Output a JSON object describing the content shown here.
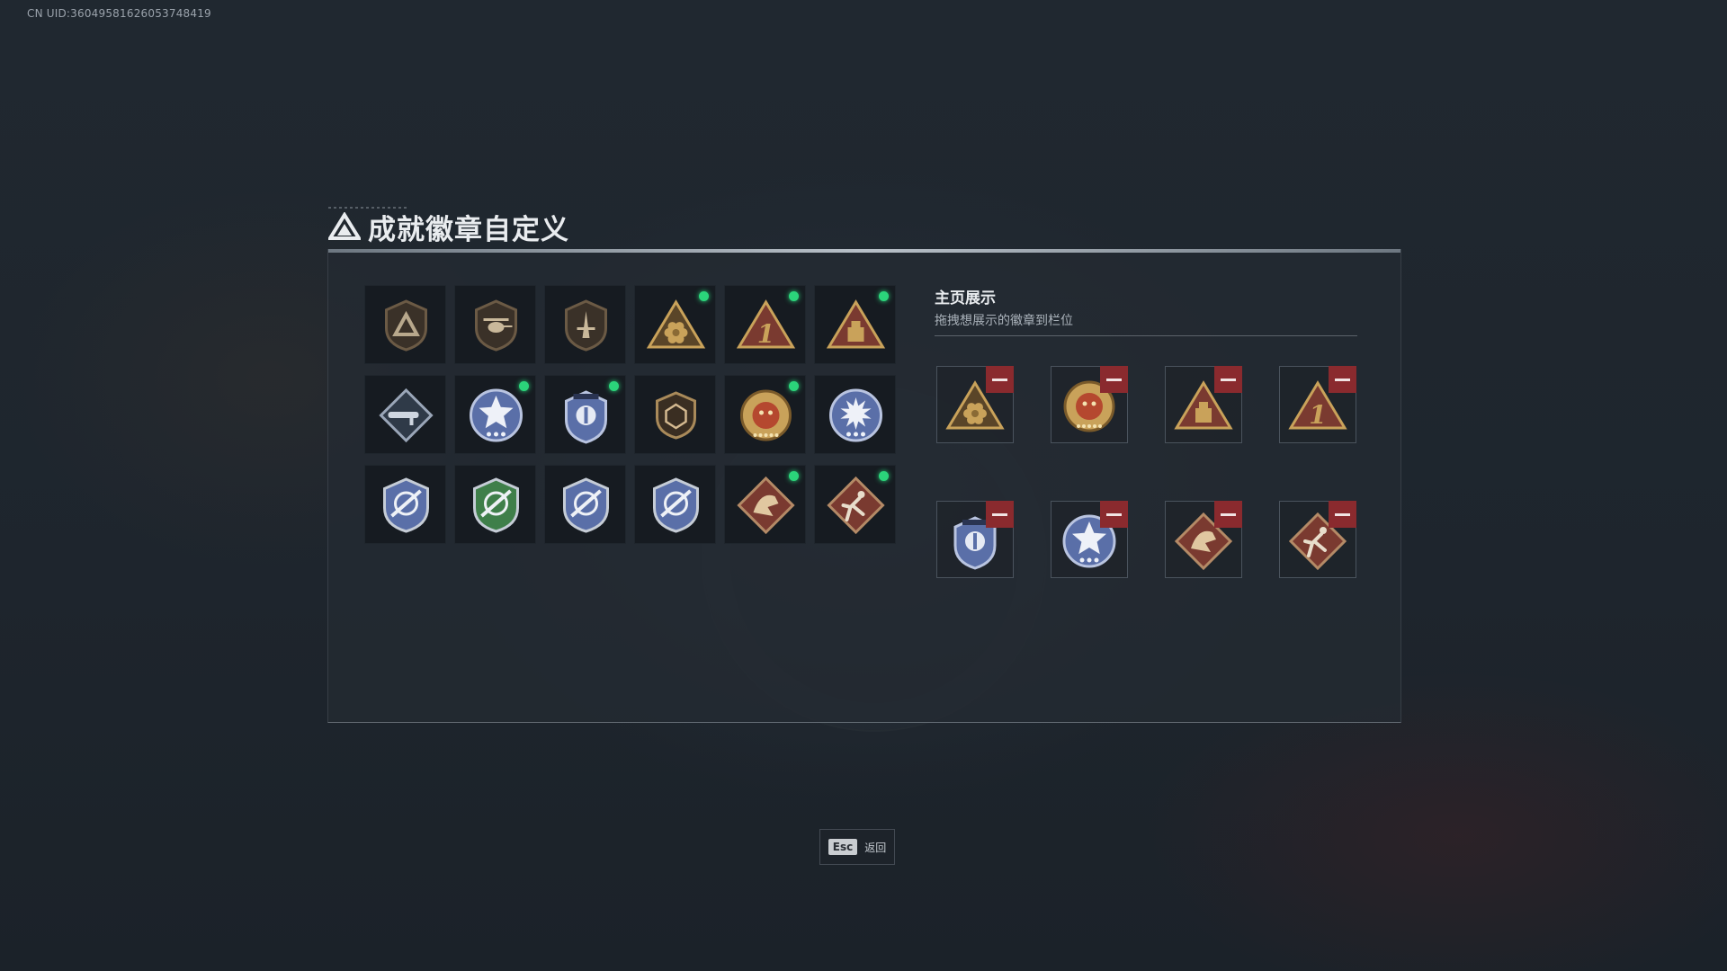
{
  "uid_text": "CN UID:36049581626053748419",
  "title": "成就徽章自定义",
  "showcase": {
    "title": "主页展示",
    "subtitle": "拖拽想展示的徽章到栏位"
  },
  "esc": {
    "key": "Esc",
    "label": "返回"
  },
  "colors": {
    "new_dot": "#2bd47a",
    "remove_button": "#8a2a2e",
    "gold": "#c9a25a",
    "blue_badge": "#5a6fa8",
    "red_badge": "#7a3a30",
    "green_badge": "#3f7f4a"
  },
  "badges": [
    {
      "icon": "triangle-shield-icon",
      "new": false
    },
    {
      "icon": "helicopter-shield-icon",
      "new": false
    },
    {
      "icon": "sword-shield-icon",
      "new": false
    },
    {
      "icon": "gold-pyramid-flower-icon",
      "new": true
    },
    {
      "icon": "red-pyramid-number-one-icon",
      "new": true
    },
    {
      "icon": "gold-pyramid-block-icon",
      "new": true
    },
    {
      "icon": "rocket-launcher-diamond-icon",
      "new": false
    },
    {
      "icon": "blue-star-emblem-icon",
      "new": true
    },
    {
      "icon": "blue-police-badge-icon",
      "new": true
    },
    {
      "icon": "bronze-hexagon-crest-icon",
      "new": false
    },
    {
      "icon": "gold-tiger-medal-icon",
      "new": true
    },
    {
      "icon": "blue-starburst-emblem-icon",
      "new": false
    },
    {
      "icon": "blue-crosshair-shield-icon",
      "new": false
    },
    {
      "icon": "green-crosshair-shield-icon",
      "new": false
    },
    {
      "icon": "blue-crosshair-shield-icon",
      "new": false
    },
    {
      "icon": "blue-crosshair-shield-icon",
      "new": false
    },
    {
      "icon": "red-dragon-diamond-icon",
      "new": true
    },
    {
      "icon": "red-runner-diamond-icon",
      "new": true
    }
  ],
  "slots": [
    {
      "icon": "gold-pyramid-flower-icon"
    },
    {
      "icon": "gold-tiger-medal-icon"
    },
    {
      "icon": "gold-pyramid-block-icon"
    },
    {
      "icon": "red-pyramid-number-one-icon"
    },
    {
      "icon": "blue-police-badge-icon"
    },
    {
      "icon": "blue-star-emblem-icon"
    },
    {
      "icon": "red-dragon-diamond-icon"
    },
    {
      "icon": "red-runner-diamond-icon"
    }
  ]
}
